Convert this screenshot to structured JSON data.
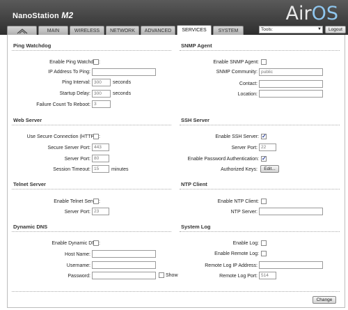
{
  "header": {
    "device_name": "NanoStation",
    "device_model": "M2",
    "logo_main": "Air",
    "logo_accent": "OS"
  },
  "tabs": [
    {
      "label": "MAIN"
    },
    {
      "label": "WIRELESS"
    },
    {
      "label": "NETWORK"
    },
    {
      "label": "ADVANCED"
    },
    {
      "label": "SERVICES"
    },
    {
      "label": "SYSTEM"
    }
  ],
  "toolbar": {
    "tools_value": "Tools:",
    "logout_label": "Logout"
  },
  "ping": {
    "title": "Ping Watchdog",
    "enable_label": "Enable Ping Watchdog:",
    "ip_label": "IP Address To Ping:",
    "ip_value": "",
    "interval_label": "Ping Interval:",
    "interval_value": "300",
    "interval_unit": "seconds",
    "delay_label": "Startup Delay:",
    "delay_value": "300",
    "delay_unit": "seconds",
    "failure_label": "Failure Count To Reboot:",
    "failure_value": "3"
  },
  "snmp": {
    "title": "SNMP Agent",
    "enable_label": "Enable SNMP Agent:",
    "community_label": "SNMP Community:",
    "community_value": "public",
    "contact_label": "Contact:",
    "contact_value": "",
    "location_label": "Location:",
    "location_value": ""
  },
  "web": {
    "title": "Web Server",
    "https_label": "Use Secure Connection (HTTPS):",
    "secure_port_label": "Secure Server Port:",
    "secure_port_value": "443",
    "port_label": "Server Port:",
    "port_value": "80",
    "timeout_label": "Session Timeout:",
    "timeout_value": "15",
    "timeout_unit": "minutes"
  },
  "ssh": {
    "title": "SSH Server",
    "enable_label": "Enable SSH Server:",
    "enabled": true,
    "port_label": "Server Port:",
    "port_value": "22",
    "pwauth_label": "Enable Password Authentication:",
    "pwauth_enabled": true,
    "keys_label": "Authorized Keys:",
    "edit_label": "Edit..."
  },
  "telnet": {
    "title": "Telnet Server",
    "enable_label": "Enable Telnet Server:",
    "port_label": "Server Port:",
    "port_value": "23"
  },
  "ntp": {
    "title": "NTP Client",
    "enable_label": "Enable NTP Client:",
    "server_label": "NTP Server:",
    "server_value": ""
  },
  "ddns": {
    "title": "Dynamic DNS",
    "enable_label": "Enable Dynamic DNS:",
    "host_label": "Host Name:",
    "host_value": "",
    "user_label": "Username:",
    "user_value": "",
    "pass_label": "Password:",
    "pass_value": "",
    "show_label": "Show"
  },
  "syslog": {
    "title": "System Log",
    "enable_label": "Enable Log:",
    "remote_label": "Enable Remote Log:",
    "remote_ip_label": "Remote Log IP Address:",
    "remote_ip_value": "",
    "remote_port_label": "Remote Log Port:",
    "remote_port_value": "514"
  },
  "footer": {
    "change_label": "Change"
  }
}
